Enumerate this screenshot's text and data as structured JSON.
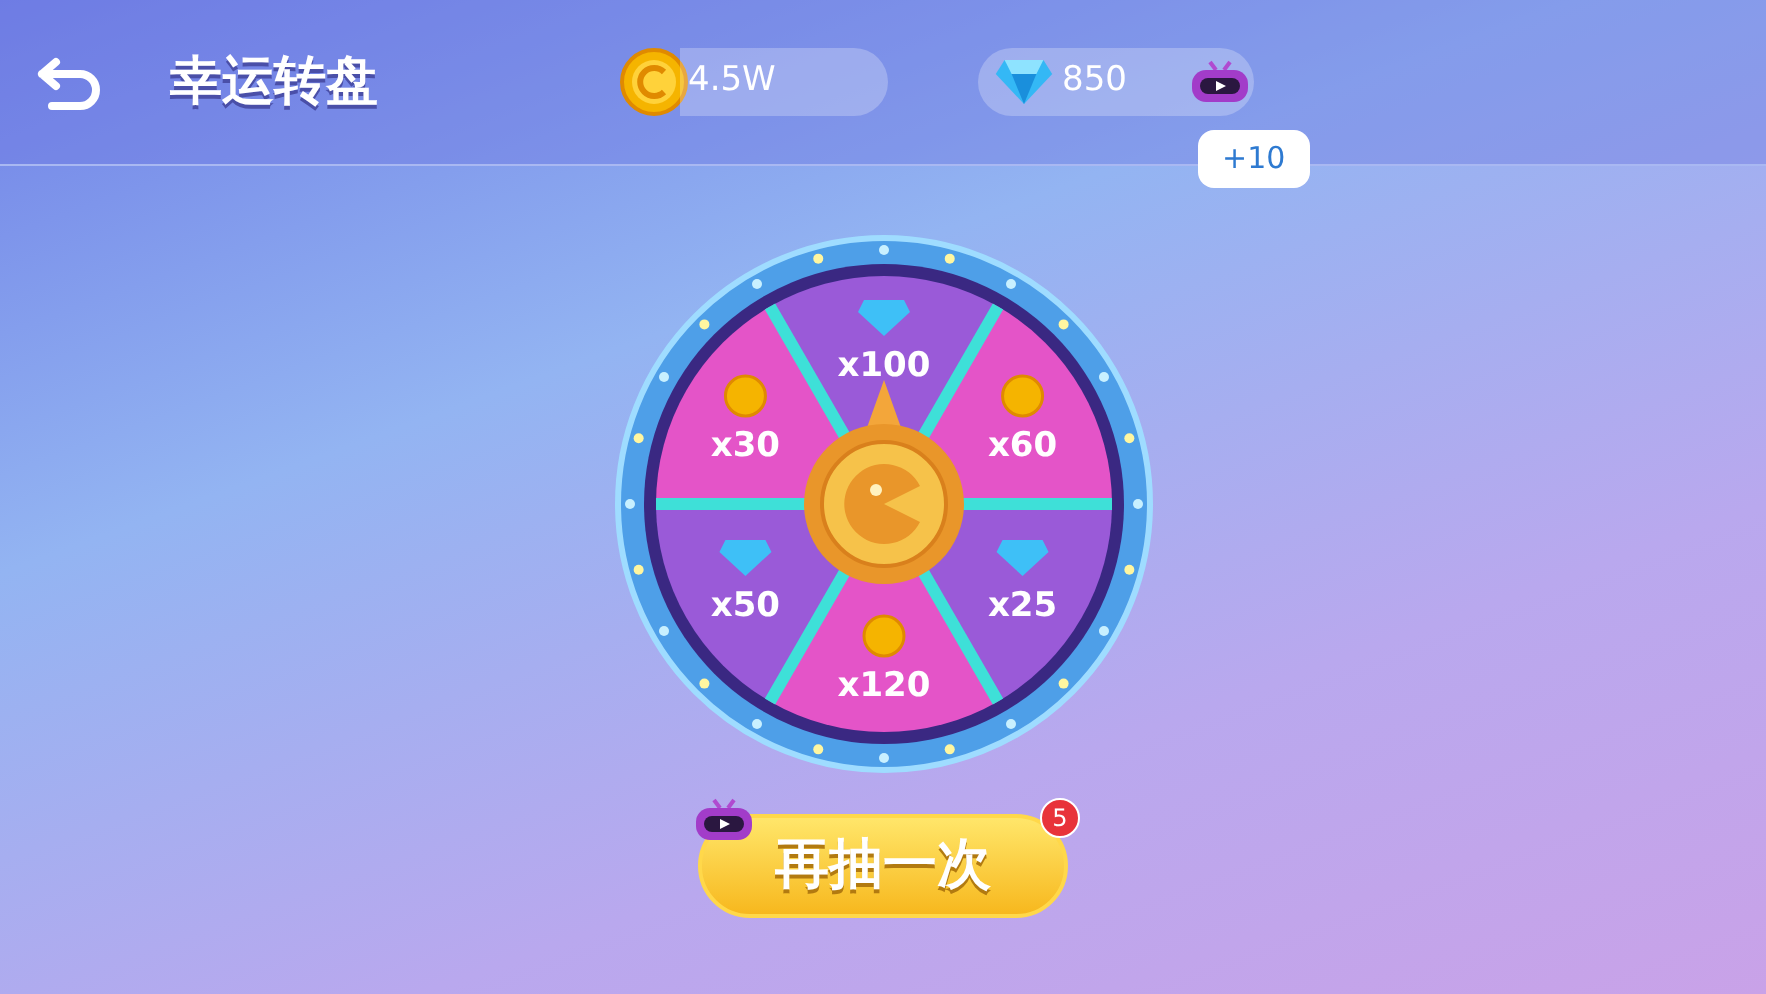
{
  "header": {
    "title": "幸运转盘"
  },
  "coins": {
    "value": "4.5W"
  },
  "diamonds": {
    "value": "850"
  },
  "video_reward": {
    "bonus": "+10"
  },
  "wheel": {
    "segments": [
      {
        "kind": "diamond",
        "label": "x100"
      },
      {
        "kind": "coin",
        "label": "x60"
      },
      {
        "kind": "diamond",
        "label": "x25"
      },
      {
        "kind": "coin",
        "label": "x120"
      },
      {
        "kind": "diamond",
        "label": "x50"
      },
      {
        "kind": "coin",
        "label": "x30"
      }
    ]
  },
  "spin_button": {
    "label": "再抽一次",
    "badge": "5"
  }
}
